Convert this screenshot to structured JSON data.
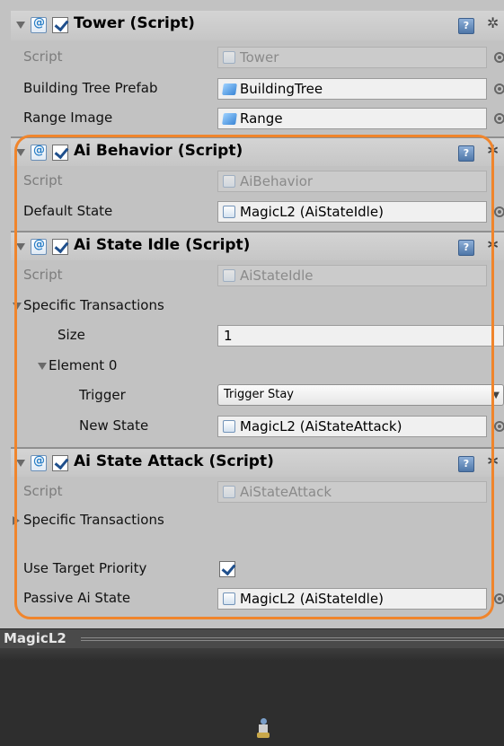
{
  "components": [
    {
      "title": "Tower (Script)",
      "enabled": true,
      "properties": [
        {
          "label": "Script",
          "value": "Tower",
          "disabled": true
        },
        {
          "label": "Building Tree Prefab",
          "value": "BuildingTree"
        },
        {
          "label": "Range Image",
          "value": "Range"
        }
      ]
    },
    {
      "title": "Ai Behavior (Script)",
      "enabled": true,
      "properties": [
        {
          "label": "Script",
          "value": "AiBehavior",
          "disabled": true
        },
        {
          "label": "Default State",
          "value": "MagicL2 (AiStateIdle)"
        }
      ]
    },
    {
      "title": "Ai State Idle (Script)",
      "enabled": true,
      "properties": [
        {
          "label": "Script",
          "value": "AiStateIdle",
          "disabled": true
        }
      ],
      "specific_transactions": {
        "label": "Specific Transactions",
        "size_label": "Size",
        "size_value": "1",
        "element_label": "Element 0",
        "trigger_label": "Trigger",
        "trigger_value": "Trigger Stay",
        "new_state_label": "New State",
        "new_state_value": "MagicL2 (AiStateAttack)"
      }
    },
    {
      "title": "Ai State Attack (Script)",
      "enabled": true,
      "properties": [
        {
          "label": "Script",
          "value": "AiStateAttack",
          "disabled": true
        }
      ],
      "specific_transactions_label": "Specific Transactions",
      "use_target_priority_label": "Use Target Priority",
      "use_target_priority_checked": true,
      "passive_state_label": "Passive Ai State",
      "passive_state_value": "MagicL2 (AiStateIdle)"
    }
  ],
  "preview": {
    "title": "MagicL2"
  },
  "colors": {
    "highlight": "#f0852c",
    "panel_bg": "#c2c2c2",
    "preview_bg": "#2e2e2e"
  }
}
